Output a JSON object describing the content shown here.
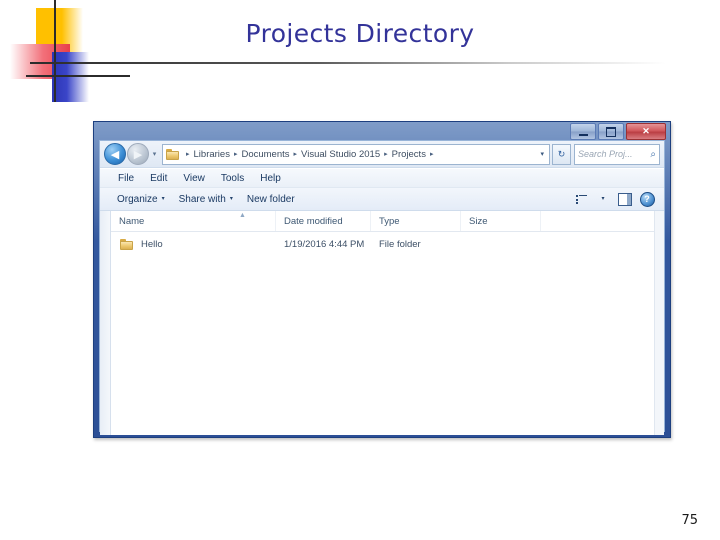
{
  "slide": {
    "title": "Projects Directory",
    "page_number": "75",
    "title_color": "#333399"
  },
  "window": {
    "controls": {
      "minimize": "minimize-button",
      "maximize": "maximize-button",
      "close_label": "✕"
    },
    "nav": {
      "back_glyph": "◀",
      "forward_glyph": "▶",
      "history_glyph": "▾",
      "refresh_glyph": "↻"
    },
    "address": {
      "leading_sep": "▸",
      "crumbs": [
        "Libraries",
        "Documents",
        "Visual Studio 2015",
        "Projects"
      ],
      "separator": "▸",
      "dropdown_glyph": "▾"
    },
    "search": {
      "placeholder": "Search Proj...",
      "icon": "🔍"
    },
    "menu": {
      "items": [
        "File",
        "Edit",
        "View",
        "Tools",
        "Help"
      ]
    },
    "commandbar": {
      "organize": "Organize",
      "share_with": "Share with",
      "new_folder": "New folder",
      "caret": "▾",
      "help_glyph": "?"
    },
    "columns": [
      {
        "label": "Name",
        "key": "name"
      },
      {
        "label": "Date modified",
        "key": "date"
      },
      {
        "label": "Type",
        "key": "type"
      },
      {
        "label": "Size",
        "key": "size"
      }
    ],
    "sort_arrow": "▲",
    "rows": [
      {
        "name": "Hello",
        "date": "1/19/2016 4:44 PM",
        "type": "File folder",
        "size": ""
      }
    ]
  }
}
